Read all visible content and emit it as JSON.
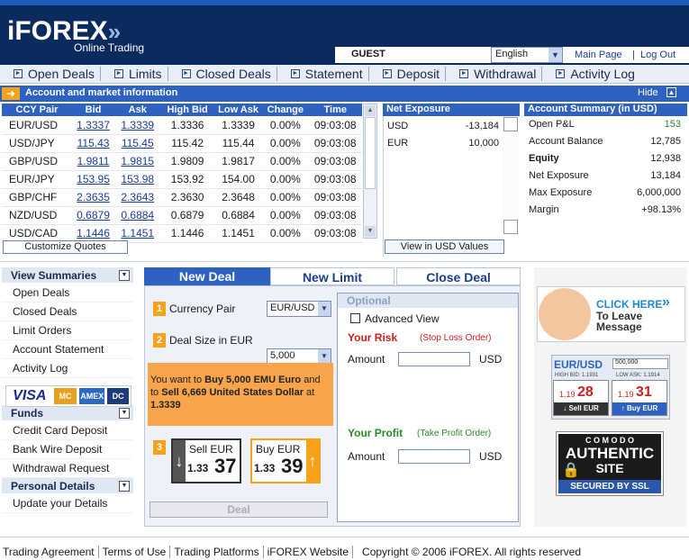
{
  "brand": {
    "logo_text": "iFOREX",
    "tagline": "Online Trading"
  },
  "userbar": {
    "user": "GUEST",
    "language": "English",
    "main_page": "Main Page",
    "log_out": "Log Out"
  },
  "nav": [
    "Open Deals",
    "Limits",
    "Closed Deals",
    "Statement",
    "Deposit",
    "Withdrawal",
    "Activity Log"
  ],
  "section": {
    "title": "Account and market information",
    "hide": "Hide"
  },
  "quotes": {
    "headers": [
      "CCY Pair",
      "Bid",
      "Ask",
      "High Bid",
      "Low Ask",
      "Change",
      "Time"
    ],
    "rows": [
      [
        "EUR/USD",
        "1.3337",
        "1.3339",
        "1.3336",
        "1.3339",
        "0.00%",
        "09:03:08"
      ],
      [
        "USD/JPY",
        "115.43",
        "115.45",
        "115.42",
        "115.44",
        "0.00%",
        "09:03:08"
      ],
      [
        "GBP/USD",
        "1.9811",
        "1.9815",
        "1.9809",
        "1.9817",
        "0.00%",
        "09:03:08"
      ],
      [
        "EUR/JPY",
        "153.95",
        "153.98",
        "153.92",
        "154.00",
        "0.00%",
        "09:03:08"
      ],
      [
        "GBP/CHF",
        "2.3635",
        "2.3643",
        "2.3630",
        "2.3648",
        "0.00%",
        "09:03:08"
      ],
      [
        "NZD/USD",
        "0.6879",
        "0.6884",
        "0.6879",
        "0.6884",
        "0.00%",
        "09:03:08"
      ],
      [
        "USD/CAD",
        "1.1446",
        "1.1451",
        "1.1446",
        "1.1451",
        "0.00%",
        "09:03:08"
      ]
    ],
    "customize": "Customize Quotes"
  },
  "net_exposure": {
    "title": "Net Exposure",
    "rows": [
      [
        "USD",
        "-13,184"
      ],
      [
        "EUR",
        "10,000"
      ]
    ],
    "view_usd": "View in USD Values"
  },
  "account_summary": {
    "title": "Account Summary (in USD)",
    "rows": [
      [
        "Open P&L",
        "153"
      ],
      [
        "Account Balance",
        "12,785"
      ],
      [
        "Equity",
        "12,938"
      ],
      [
        "Net Exposure",
        "13,184"
      ],
      [
        "Max Exposure",
        "6,000,000"
      ],
      [
        "Margin",
        "+98.13%"
      ]
    ]
  },
  "sidebar": {
    "view_summaries": "View Summaries",
    "summary_items": [
      "Open Deals",
      "Closed Deals",
      "Limit Orders",
      "Account Statement",
      "Activity Log"
    ],
    "cards": [
      "VISA",
      "MC",
      "AMEX",
      "DC"
    ],
    "funds": "Funds",
    "fund_items": [
      "Credit Card Deposit",
      "Bank Wire Deposit",
      "Withdrawal Request"
    ],
    "personal": "Personal Details",
    "personal_items": [
      "Update your Details"
    ]
  },
  "deal": {
    "tabs": [
      "New Deal",
      "New Limit",
      "Close Deal"
    ],
    "step1": "1",
    "currency_pair_label": "Currency Pair",
    "currency_pair_value": "EUR/USD",
    "step2": "2",
    "deal_size_label": "Deal Size in EUR",
    "deal_size_value": "5,000",
    "want_a": "You want to",
    "want_b": "Buy 5,000 EMU Euro",
    "want_c": "and to",
    "want_d": "Sell 6,669 United States Dollar",
    "want_e": "at",
    "want_f": "1.3339",
    "step3": "3",
    "sell_label": "Sell",
    "sell_ccy": "EUR",
    "sell_small": "1.33",
    "sell_big": "37",
    "buy_label": "Buy",
    "buy_ccy": "EUR",
    "buy_small": "1.33",
    "buy_big": "39",
    "deal_button": "Deal",
    "optional": "Optional",
    "advanced_view": "Advanced View",
    "your_risk": "Your Risk",
    "stop_loss": "(Stop Loss Order)",
    "amount": "Amount",
    "usd": "USD",
    "your_profit": "Your Profit",
    "take_profit": "(Take Profit Order)"
  },
  "promo": {
    "click_here": "CLICK HERE",
    "leave1": "To Leave",
    "leave2": "Message",
    "mini_pair": "EUR/USD",
    "mini_size": "500,000",
    "mini_high": "HIGH BID: 1.1931",
    "mini_low": "LOW ASK: 1.1914",
    "mini_sell_small": "1.19",
    "mini_sell_big": "28",
    "mini_buy_small": "1.19",
    "mini_buy_big": "31",
    "mini_sell": "Sell EUR",
    "mini_buy": "Buy EUR",
    "comodo1": "C O M O D O",
    "comodo2": "AUTHENTIC",
    "comodo3": "SITE",
    "comodo4": "SECURED BY SSL"
  },
  "footer": {
    "links": [
      "Trading Agreement",
      "Terms of Use",
      "Trading Platforms",
      "iFOREX Website"
    ],
    "copyright": "Copyright © 2006 iFOREX. All rights reserved"
  },
  "colors": {
    "navy": "#0b2a5e",
    "blue": "#2d62c2",
    "orange": "#f7a21c",
    "green": "#2a8a2a",
    "red": "#c9201e"
  }
}
